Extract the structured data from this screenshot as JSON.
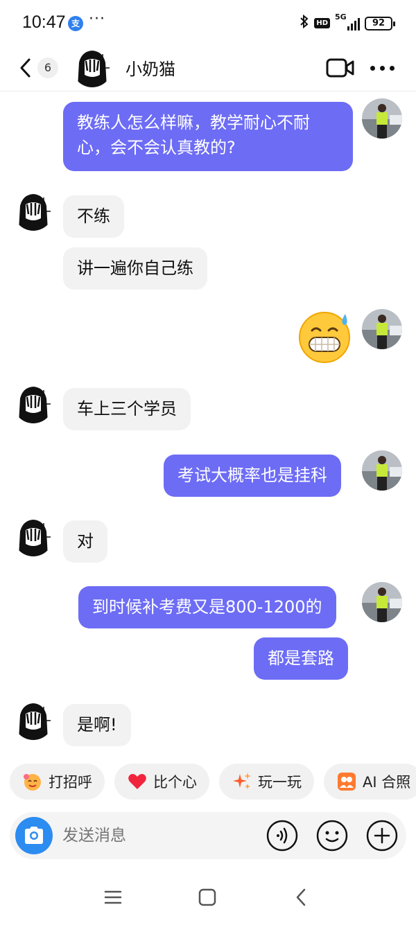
{
  "status_bar": {
    "time": "10:47",
    "app_badge": "支",
    "more": "···",
    "hd": "HD",
    "network": "5G",
    "battery": "92"
  },
  "header": {
    "unread_count": "6",
    "contact_name": "小奶猫"
  },
  "messages": [
    {
      "from": "me",
      "text_lines": [
        "教练人怎么样嘛，教学耐心不耐",
        "心，会不会认真教的?"
      ]
    },
    {
      "from": "them",
      "text": "不练"
    },
    {
      "from": "them",
      "text": "讲一遍你自己练"
    },
    {
      "from": "me",
      "type": "sticker",
      "icon": "grimacing-sweat-emoji"
    },
    {
      "from": "them",
      "text": "车上三个学员"
    },
    {
      "from": "me",
      "text": "考试大概率也是挂科"
    },
    {
      "from": "them",
      "text": "对"
    },
    {
      "from": "me",
      "text": "到时候补考费又是800-1200的"
    },
    {
      "from": "me",
      "text": "都是套路"
    },
    {
      "from": "them",
      "text": "是啊!"
    }
  ],
  "quick_replies": [
    {
      "label": "打招呼",
      "icon": "wave-emoji-icon"
    },
    {
      "label": "比个心",
      "icon": "heart-icon"
    },
    {
      "label": "玩一玩",
      "icon": "sparkle-icon"
    },
    {
      "label": "AI 合照",
      "icon": "ai-photo-icon"
    }
  ],
  "input": {
    "placeholder": "发送消息"
  },
  "colors": {
    "my_bubble": "#6d6cf5",
    "their_bubble": "#f2f2f2",
    "camera_button": "#2d8cf0"
  }
}
